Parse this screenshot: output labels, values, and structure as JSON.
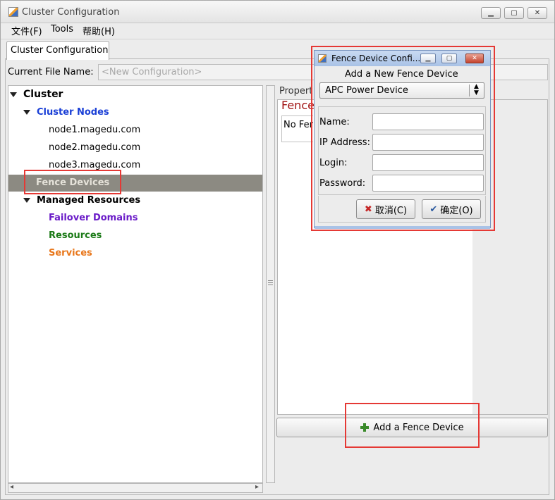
{
  "window": {
    "title": "Cluster Configuration"
  },
  "menu": {
    "file": "文件(F)",
    "tools": "Tools",
    "help": "帮助(H)"
  },
  "tab": {
    "label": "Cluster Configuration"
  },
  "file_row": {
    "label": "Current File Name:",
    "placeholder": "<New Configuration>"
  },
  "tree": {
    "root": "Cluster",
    "cluster_nodes": "Cluster Nodes",
    "nodes": [
      "node1.magedu.com",
      "node2.magedu.com",
      "node3.magedu.com"
    ],
    "fence_devices": "Fence Devices",
    "managed_resources": "Managed Resources",
    "failover_domains": "Failover Domains",
    "resources": "Resources",
    "services": "Services"
  },
  "properties": {
    "label": "Propert",
    "heading": "Fence",
    "text": "No Fer"
  },
  "add_button": {
    "label": "Add a Fence Device"
  },
  "dialog": {
    "title": "Fence Device Confi...",
    "subtitle": "Add a New Fence Device",
    "device_type": "APC Power Device",
    "fields": {
      "name": "Name:",
      "ip": "IP Address:",
      "login": "Login:",
      "password": "Password:"
    },
    "cancel": "取消(C)",
    "ok": "确定(O)"
  },
  "colors": {
    "cluster_nodes": "#1a3fd6",
    "failover": "#6a1bc8",
    "resources": "#1b7a17",
    "services": "#e8761a",
    "selected_row": "#8c8a82",
    "highlight": "#e53935",
    "fence_heading": "#a01010"
  },
  "icons": [
    "app-icon",
    "minimize-icon",
    "maximize-icon",
    "close-icon",
    "expand-triangle-icon",
    "plus-icon",
    "cancel-x-icon",
    "ok-check-icon",
    "dropdown-arrows-icon"
  ]
}
